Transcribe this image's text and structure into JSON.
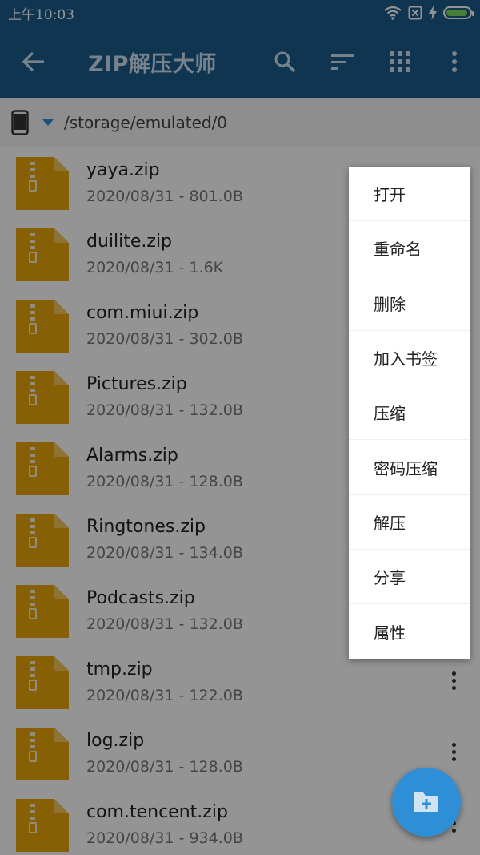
{
  "status_bar": {
    "time": "上午10:03"
  },
  "app_bar": {
    "title": "ZIP解压大师"
  },
  "path_bar": {
    "path": "/storage/emulated/0"
  },
  "files": [
    {
      "name": "yaya.zip",
      "meta": "2020/08/31 - 801.0B"
    },
    {
      "name": "duilite.zip",
      "meta": "2020/08/31 - 1.6K"
    },
    {
      "name": "com.miui.zip",
      "meta": "2020/08/31 - 302.0B"
    },
    {
      "name": "Pictures.zip",
      "meta": "2020/08/31 - 132.0B"
    },
    {
      "name": "Alarms.zip",
      "meta": "2020/08/31 - 128.0B"
    },
    {
      "name": "Ringtones.zip",
      "meta": "2020/08/31 - 134.0B"
    },
    {
      "name": "Podcasts.zip",
      "meta": "2020/08/31 - 132.0B"
    },
    {
      "name": "tmp.zip",
      "meta": "2020/08/31 - 122.0B"
    },
    {
      "name": "log.zip",
      "meta": "2020/08/31 - 128.0B"
    },
    {
      "name": "com.tencent.zip",
      "meta": "2020/08/31 - 934.0B"
    }
  ],
  "popup_menu": {
    "items": [
      "打开",
      "重命名",
      "删除",
      "加入书签",
      "压缩",
      "密码压缩",
      "解压",
      "分享",
      "属性"
    ]
  },
  "colors": {
    "app_bar": "#1a5c8c",
    "zip_icon": "#e8a50a",
    "fab": "#2f8fd6"
  }
}
